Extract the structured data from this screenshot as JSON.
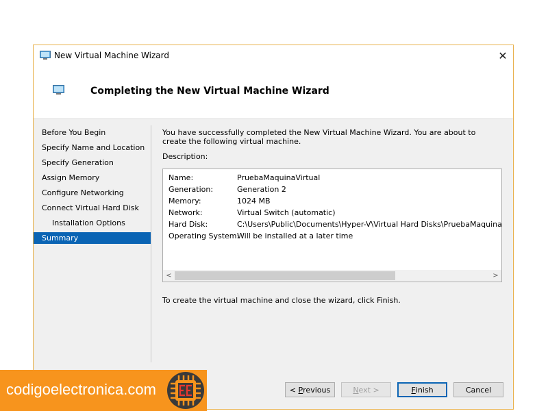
{
  "window": {
    "title": "New Virtual Machine Wizard",
    "close_glyph": "✕",
    "header_title": "Completing the New Virtual Machine Wizard",
    "border_color": "#e8b04a"
  },
  "nav": {
    "items": [
      {
        "label": "Before You Begin"
      },
      {
        "label": "Specify Name and Location"
      },
      {
        "label": "Specify Generation"
      },
      {
        "label": "Assign Memory"
      },
      {
        "label": "Configure Networking"
      },
      {
        "label": "Connect Virtual Hard Disk"
      },
      {
        "label": "Installation Options"
      },
      {
        "label": "Summary"
      }
    ],
    "selected_color": "#0a64b4"
  },
  "content": {
    "intro": "You have successfully completed the New Virtual Machine Wizard. You are about to create the following virtual machine.",
    "description_label": "Description:",
    "rows": [
      {
        "key": "Name:",
        "value": "PruebaMaquinaVirtual"
      },
      {
        "key": "Generation:",
        "value": "Generation 2"
      },
      {
        "key": "Memory:",
        "value": "1024 MB"
      },
      {
        "key": "Network:",
        "value": "Virtual Switch (automatic)"
      },
      {
        "key": "Hard Disk:",
        "value": "C:\\Users\\Public\\Documents\\Hyper-V\\Virtual Hard Disks\\PruebaMaquinaVirtual.vhdx (VHDX, dynamically expanding)"
      },
      {
        "key": "Operating System:",
        "value": "Will be installed at a later time"
      }
    ],
    "scroll": {
      "left_glyph": "<",
      "right_glyph": ">",
      "visible_fraction": 0.7
    },
    "finish_note": "To create the virtual machine and close the wizard, click Finish."
  },
  "buttons": {
    "previous": {
      "prefix": "< ",
      "accel": "P",
      "rest": "revious"
    },
    "next": {
      "accel": "N",
      "rest": "ext >"
    },
    "finish": {
      "accel": "F",
      "rest": "inish"
    },
    "cancel": {
      "label": "Cancel"
    }
  },
  "watermark": {
    "text": "codigoelectronica.com",
    "background": "#f7941d"
  }
}
